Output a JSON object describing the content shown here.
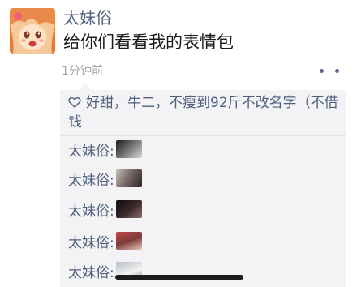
{
  "post": {
    "author": "太妹俗",
    "text": "给你们看看我的表情包",
    "time": "1分钟前"
  },
  "icons": {
    "more": "more-options-icon",
    "like": "heart-icon"
  },
  "likes": {
    "text": "好甜，牛二，不瘦到92斤不改名字（不借钱"
  },
  "comments": [
    {
      "author": "太妹俗:",
      "sticker": "sticker-image"
    },
    {
      "author": "太妹俗:",
      "sticker": "sticker-image"
    },
    {
      "author": "太妹俗:",
      "sticker": "sticker-image"
    },
    {
      "author": "太妹俗:",
      "sticker": "sticker-image"
    },
    {
      "author": "太妹俗:",
      "sticker": "sticker-image"
    }
  ],
  "colors": {
    "name_link": "#51607f",
    "comment_bg": "#f3f3f5",
    "time": "#a3a3a3"
  }
}
